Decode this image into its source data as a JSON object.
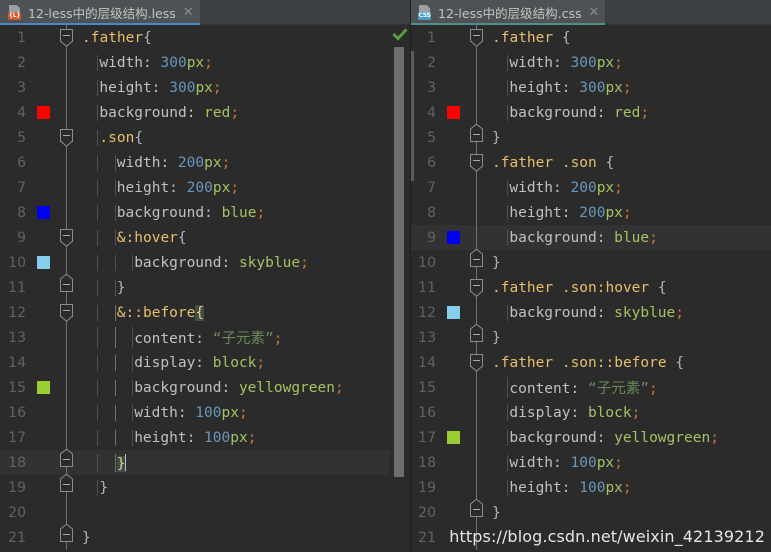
{
  "theme": {
    "background": "#2b2b2b",
    "tabbar_background": "#3c3f41",
    "active_tab_background": "#4e5254",
    "current_line_background": "#323232",
    "line_number_color": "#606366",
    "default_text": "#a9b7c6",
    "selector_color": "#e8bf6a",
    "number_color": "#6897bb",
    "keyword_color": "#a5c261",
    "string_color": "#6a8759",
    "punctuation_color": "#cc7832",
    "accent_less_tab": "#4a88c7",
    "accent_css_tab": "#4f8f8a"
  },
  "left_pane": {
    "tab": {
      "label": "12-less中的层级结构.less",
      "icon": "less-file-icon",
      "badge_text": "{L}",
      "close_label": "✕",
      "active": true
    },
    "inspection_status": "ok-check-icon",
    "lines": [
      {
        "n": "1",
        "swatch": null,
        "fold": "start",
        "indent_guides": 0,
        "current": false,
        "tokens": [
          {
            "t": ".father",
            "c": "sel"
          },
          {
            "t": "{",
            "c": "brace"
          }
        ],
        "indent": 0
      },
      {
        "n": "2",
        "swatch": null,
        "fold": "line",
        "indent_guides": 1,
        "current": false,
        "tokens": [
          {
            "t": "width: ",
            "c": "prop"
          },
          {
            "t": "300",
            "c": "num"
          },
          {
            "t": "px",
            "c": "unit"
          },
          {
            "t": ";",
            "c": "punc"
          }
        ],
        "indent": 1
      },
      {
        "n": "3",
        "swatch": null,
        "fold": "line",
        "indent_guides": 1,
        "current": false,
        "tokens": [
          {
            "t": "height: ",
            "c": "prop"
          },
          {
            "t": "300",
            "c": "num"
          },
          {
            "t": "px",
            "c": "unit"
          },
          {
            "t": ";",
            "c": "punc"
          }
        ],
        "indent": 1
      },
      {
        "n": "4",
        "swatch": "#ff0000",
        "fold": "line",
        "indent_guides": 1,
        "current": false,
        "tokens": [
          {
            "t": "background: ",
            "c": "prop"
          },
          {
            "t": "red",
            "c": "kw"
          },
          {
            "t": ";",
            "c": "punc"
          }
        ],
        "indent": 1
      },
      {
        "n": "5",
        "swatch": null,
        "fold": "start",
        "indent_guides": 1,
        "current": false,
        "tokens": [
          {
            "t": ".son",
            "c": "sel"
          },
          {
            "t": "{",
            "c": "brace"
          }
        ],
        "indent": 1
      },
      {
        "n": "6",
        "swatch": null,
        "fold": "line",
        "indent_guides": 2,
        "current": false,
        "tokens": [
          {
            "t": "width: ",
            "c": "prop"
          },
          {
            "t": "200",
            "c": "num"
          },
          {
            "t": "px",
            "c": "unit"
          },
          {
            "t": ";",
            "c": "punc"
          }
        ],
        "indent": 2
      },
      {
        "n": "7",
        "swatch": null,
        "fold": "line",
        "indent_guides": 2,
        "current": false,
        "tokens": [
          {
            "t": "height: ",
            "c": "prop"
          },
          {
            "t": "200",
            "c": "num"
          },
          {
            "t": "px",
            "c": "unit"
          },
          {
            "t": ";",
            "c": "punc"
          }
        ],
        "indent": 2
      },
      {
        "n": "8",
        "swatch": "#0000f0",
        "fold": "line",
        "indent_guides": 2,
        "current": false,
        "tokens": [
          {
            "t": "background: ",
            "c": "prop"
          },
          {
            "t": "blue",
            "c": "kw"
          },
          {
            "t": ";",
            "c": "punc"
          }
        ],
        "indent": 2
      },
      {
        "n": "9",
        "swatch": null,
        "fold": "start",
        "indent_guides": 2,
        "current": false,
        "tokens": [
          {
            "t": "&",
            "c": "amp"
          },
          {
            "t": ":hover",
            "c": "pseudo"
          },
          {
            "t": "{",
            "c": "brace"
          }
        ],
        "indent": 2
      },
      {
        "n": "10",
        "swatch": "#87ceeb",
        "fold": "line",
        "indent_guides": 3,
        "current": false,
        "tokens": [
          {
            "t": "background: ",
            "c": "prop"
          },
          {
            "t": "skyblue",
            "c": "kw"
          },
          {
            "t": ";",
            "c": "punc"
          }
        ],
        "indent": 3
      },
      {
        "n": "11",
        "swatch": null,
        "fold": "end",
        "indent_guides": 2,
        "current": false,
        "tokens": [
          {
            "t": "}",
            "c": "brace"
          }
        ],
        "indent": 2
      },
      {
        "n": "12",
        "swatch": null,
        "fold": "start",
        "indent_guides": 2,
        "current": false,
        "tokens": [
          {
            "t": "&",
            "c": "amp"
          },
          {
            "t": "::before",
            "c": "pseudo"
          },
          {
            "t": "{",
            "c": "brace-hl"
          }
        ],
        "indent": 2
      },
      {
        "n": "13",
        "swatch": null,
        "fold": "line",
        "indent_guides": 3,
        "current": false,
        "tokens": [
          {
            "t": "content: ",
            "c": "prop"
          },
          {
            "t": "“子元素”",
            "c": "str"
          },
          {
            "t": ";",
            "c": "punc"
          }
        ],
        "indent": 3
      },
      {
        "n": "14",
        "swatch": null,
        "fold": "line",
        "indent_guides": 3,
        "current": false,
        "tokens": [
          {
            "t": "display: ",
            "c": "prop"
          },
          {
            "t": "block",
            "c": "kw"
          },
          {
            "t": ";",
            "c": "punc"
          }
        ],
        "indent": 3
      },
      {
        "n": "15",
        "swatch": "#9acd32",
        "fold": "line",
        "indent_guides": 3,
        "current": false,
        "tokens": [
          {
            "t": "background: ",
            "c": "prop"
          },
          {
            "t": "yellowgreen",
            "c": "kw"
          },
          {
            "t": ";",
            "c": "punc"
          }
        ],
        "indent": 3
      },
      {
        "n": "16",
        "swatch": null,
        "fold": "line",
        "indent_guides": 3,
        "current": false,
        "tokens": [
          {
            "t": "width: ",
            "c": "prop"
          },
          {
            "t": "100",
            "c": "num"
          },
          {
            "t": "px",
            "c": "unit"
          },
          {
            "t": ";",
            "c": "punc"
          }
        ],
        "indent": 3
      },
      {
        "n": "17",
        "swatch": null,
        "fold": "line",
        "indent_guides": 3,
        "current": false,
        "tokens": [
          {
            "t": "height: ",
            "c": "prop"
          },
          {
            "t": "100",
            "c": "num"
          },
          {
            "t": "px",
            "c": "unit"
          },
          {
            "t": ";",
            "c": "punc"
          }
        ],
        "indent": 3
      },
      {
        "n": "18",
        "swatch": null,
        "fold": "end",
        "indent_guides": 2,
        "current": true,
        "tokens": [
          {
            "t": "}",
            "c": "brace-hl"
          },
          {
            "t": "",
            "c": "cursor"
          }
        ],
        "indent": 2
      },
      {
        "n": "19",
        "swatch": null,
        "fold": "end",
        "indent_guides": 1,
        "current": false,
        "tokens": [
          {
            "t": "}",
            "c": "brace"
          }
        ],
        "indent": 1
      },
      {
        "n": "20",
        "swatch": null,
        "fold": "line",
        "indent_guides": 1,
        "current": false,
        "tokens": [],
        "indent": 0
      },
      {
        "n": "21",
        "swatch": null,
        "fold": "end",
        "indent_guides": 0,
        "current": false,
        "tokens": [
          {
            "t": "}",
            "c": "brace"
          }
        ],
        "indent": 0
      }
    ]
  },
  "right_pane": {
    "tab": {
      "label": "12-less中的层级结构.css",
      "icon": "css-file-icon",
      "badge_text": "CSS",
      "close_label": "✕",
      "active": true
    },
    "lines": [
      {
        "n": "1",
        "swatch": null,
        "fold": "start",
        "current": false,
        "tokens": [
          {
            "t": ".father",
            "c": "sel"
          },
          {
            "t": " {",
            "c": "brace"
          }
        ],
        "indent": 0
      },
      {
        "n": "2",
        "swatch": null,
        "fold": "line",
        "current": false,
        "tokens": [
          {
            "t": "width: ",
            "c": "prop"
          },
          {
            "t": "300",
            "c": "num"
          },
          {
            "t": "px",
            "c": "unit"
          },
          {
            "t": ";",
            "c": "punc"
          }
        ],
        "indent": 1
      },
      {
        "n": "3",
        "swatch": null,
        "fold": "line",
        "current": false,
        "tokens": [
          {
            "t": "height: ",
            "c": "prop"
          },
          {
            "t": "300",
            "c": "num"
          },
          {
            "t": "px",
            "c": "unit"
          },
          {
            "t": ";",
            "c": "punc"
          }
        ],
        "indent": 1
      },
      {
        "n": "4",
        "swatch": "#ff0000",
        "fold": "line",
        "current": false,
        "tokens": [
          {
            "t": "background: ",
            "c": "prop"
          },
          {
            "t": "red",
            "c": "kw"
          },
          {
            "t": ";",
            "c": "punc"
          }
        ],
        "indent": 1
      },
      {
        "n": "5",
        "swatch": null,
        "fold": "end",
        "current": false,
        "tokens": [
          {
            "t": "}",
            "c": "brace"
          }
        ],
        "indent": 0
      },
      {
        "n": "6",
        "swatch": null,
        "fold": "start",
        "current": false,
        "tokens": [
          {
            "t": ".father .son",
            "c": "sel"
          },
          {
            "t": " {",
            "c": "brace"
          }
        ],
        "indent": 0
      },
      {
        "n": "7",
        "swatch": null,
        "fold": "line",
        "current": false,
        "tokens": [
          {
            "t": "width: ",
            "c": "prop"
          },
          {
            "t": "200",
            "c": "num"
          },
          {
            "t": "px",
            "c": "unit"
          },
          {
            "t": ";",
            "c": "punc"
          }
        ],
        "indent": 1
      },
      {
        "n": "8",
        "swatch": null,
        "fold": "line",
        "current": false,
        "tokens": [
          {
            "t": "height: ",
            "c": "prop"
          },
          {
            "t": "200",
            "c": "num"
          },
          {
            "t": "px",
            "c": "unit"
          },
          {
            "t": ";",
            "c": "punc"
          }
        ],
        "indent": 1
      },
      {
        "n": "9",
        "swatch": "#0000f0",
        "fold": "line",
        "current": true,
        "tokens": [
          {
            "t": "background: ",
            "c": "prop"
          },
          {
            "t": "blue",
            "c": "kw"
          },
          {
            "t": ";",
            "c": "punc"
          }
        ],
        "indent": 1
      },
      {
        "n": "10",
        "swatch": null,
        "fold": "end",
        "current": false,
        "tokens": [
          {
            "t": "}",
            "c": "brace"
          }
        ],
        "indent": 0
      },
      {
        "n": "11",
        "swatch": null,
        "fold": "start",
        "current": false,
        "tokens": [
          {
            "t": ".father .son",
            "c": "sel"
          },
          {
            "t": ":hover",
            "c": "pseudo"
          },
          {
            "t": " {",
            "c": "brace"
          }
        ],
        "indent": 0
      },
      {
        "n": "12",
        "swatch": "#87ceeb",
        "fold": "line",
        "current": false,
        "tokens": [
          {
            "t": "background: ",
            "c": "prop"
          },
          {
            "t": "skyblue",
            "c": "kw"
          },
          {
            "t": ";",
            "c": "punc"
          }
        ],
        "indent": 1
      },
      {
        "n": "13",
        "swatch": null,
        "fold": "end",
        "current": false,
        "tokens": [
          {
            "t": "}",
            "c": "brace"
          }
        ],
        "indent": 0
      },
      {
        "n": "14",
        "swatch": null,
        "fold": "start",
        "current": false,
        "tokens": [
          {
            "t": ".father .son",
            "c": "sel"
          },
          {
            "t": "::before",
            "c": "pseudo"
          },
          {
            "t": " {",
            "c": "brace"
          }
        ],
        "indent": 0
      },
      {
        "n": "15",
        "swatch": null,
        "fold": "line",
        "current": false,
        "tokens": [
          {
            "t": "content: ",
            "c": "prop"
          },
          {
            "t": "“子元素”",
            "c": "str"
          },
          {
            "t": ";",
            "c": "punc"
          }
        ],
        "indent": 1
      },
      {
        "n": "16",
        "swatch": null,
        "fold": "line",
        "current": false,
        "tokens": [
          {
            "t": "display: ",
            "c": "prop"
          },
          {
            "t": "block",
            "c": "kw"
          },
          {
            "t": ";",
            "c": "punc"
          }
        ],
        "indent": 1
      },
      {
        "n": "17",
        "swatch": "#9acd32",
        "fold": "line",
        "current": false,
        "tokens": [
          {
            "t": "background: ",
            "c": "prop"
          },
          {
            "t": "yellowgreen",
            "c": "kw"
          },
          {
            "t": ";",
            "c": "punc"
          }
        ],
        "indent": 1
      },
      {
        "n": "18",
        "swatch": null,
        "fold": "line",
        "current": false,
        "tokens": [
          {
            "t": "width: ",
            "c": "prop"
          },
          {
            "t": "100",
            "c": "num"
          },
          {
            "t": "px",
            "c": "unit"
          },
          {
            "t": ";",
            "c": "punc"
          }
        ],
        "indent": 1
      },
      {
        "n": "19",
        "swatch": null,
        "fold": "line",
        "current": false,
        "tokens": [
          {
            "t": "height: ",
            "c": "prop"
          },
          {
            "t": "100",
            "c": "num"
          },
          {
            "t": "px",
            "c": "unit"
          },
          {
            "t": ";",
            "c": "punc"
          }
        ],
        "indent": 1
      },
      {
        "n": "20",
        "swatch": null,
        "fold": "end",
        "current": false,
        "tokens": [
          {
            "t": "}",
            "c": "brace"
          }
        ],
        "indent": 0
      },
      {
        "n": "21",
        "swatch": null,
        "fold": "line",
        "current": false,
        "tokens": [],
        "indent": 0
      }
    ]
  },
  "watermark": {
    "text": "https://blog.csdn.net/weixin_42139212"
  }
}
